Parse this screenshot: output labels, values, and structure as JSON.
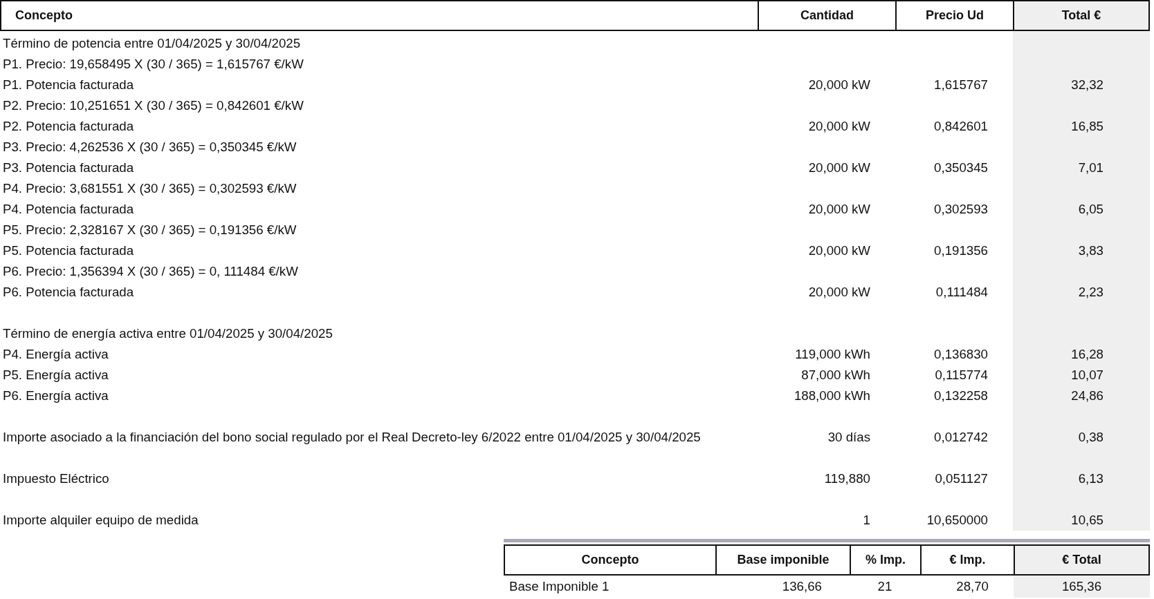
{
  "table": {
    "columns": [
      {
        "label": "Concepto",
        "highlighted": false
      },
      {
        "label": "Cantidad",
        "highlighted": false
      },
      {
        "label": "Precio Ud",
        "highlighted": false
      },
      {
        "label": "Total €",
        "highlighted": true
      }
    ],
    "sections": [
      {
        "rows": [
          {
            "kind": "heading",
            "concept": "Término de potencia entre 01/04/2025 y 30/04/2025"
          },
          {
            "kind": "heading",
            "concept": "P1. Precio: 19,658495 X (30 / 365) = 1,615767 €/kW"
          },
          {
            "kind": "item",
            "concept": "P1. Potencia facturada",
            "quantity": "20,000 kW",
            "price": "1,615767",
            "total": "32,32"
          },
          {
            "kind": "heading",
            "concept": "P2. Precio: 10,251651 X (30 / 365) = 0,842601 €/kW"
          },
          {
            "kind": "item",
            "concept": "P2. Potencia facturada",
            "quantity": "20,000 kW",
            "price": "0,842601",
            "total": "16,85"
          },
          {
            "kind": "heading",
            "concept": "P3. Precio: 4,262536 X (30 / 365) = 0,350345 €/kW"
          },
          {
            "kind": "item",
            "concept": "P3. Potencia facturada",
            "quantity": "20,000 kW",
            "price": "0,350345",
            "total": "7,01"
          },
          {
            "kind": "heading",
            "concept": "P4. Precio: 3,681551 X (30 / 365) = 0,302593 €/kW"
          },
          {
            "kind": "item",
            "concept": "P4. Potencia facturada",
            "quantity": "20,000 kW",
            "price": "0,302593",
            "total": "6,05"
          },
          {
            "kind": "heading",
            "concept": "P5. Precio: 2,328167 X (30 / 365) = 0,191356 €/kW"
          },
          {
            "kind": "item",
            "concept": "P5. Potencia facturada",
            "quantity": "20,000 kW",
            "price": "0,191356",
            "total": "3,83"
          },
          {
            "kind": "heading",
            "concept": "P6. Precio: 1,356394 X (30 / 365) = 0, 111484 €/kW"
          },
          {
            "kind": "item",
            "concept": "P6. Potencia facturada",
            "quantity": "20,000 kW",
            "price": "0,111484",
            "total": "2,23"
          }
        ]
      },
      {
        "rows": [
          {
            "kind": "heading",
            "concept": "Término de energía activa entre 01/04/2025 y 30/04/2025"
          },
          {
            "kind": "item",
            "concept": "P4. Energía activa",
            "quantity": "119,000 kWh",
            "price": "0,136830",
            "total": "16,28"
          },
          {
            "kind": "item",
            "concept": "P5. Energía activa",
            "quantity": "87,000 kWh",
            "price": "0,115774",
            "total": "10,07"
          },
          {
            "kind": "item",
            "concept": "P6. Energía activa",
            "quantity": "188,000 kWh",
            "price": "0,132258",
            "total": "24,86"
          }
        ]
      },
      {
        "rows": [
          {
            "kind": "item",
            "concept": "Importe asociado a la financiación del bono social regulado por el Real Decreto-ley 6/2022 entre 01/04/2025 y 30/04/2025",
            "quantity": "30 días",
            "price": "0,012742",
            "total": "0,38"
          }
        ]
      },
      {
        "rows": [
          {
            "kind": "item",
            "concept": "Impuesto Eléctrico",
            "quantity": "119,880",
            "price": "0,051127",
            "total": "6,13"
          }
        ]
      },
      {
        "rows": [
          {
            "kind": "item",
            "concept": "Importe alquiler equipo de medida",
            "quantity": "1",
            "price": "10,650000",
            "total": "10,65"
          }
        ]
      }
    ]
  },
  "tax_table": {
    "columns": [
      {
        "label": "Concepto",
        "highlighted": false
      },
      {
        "label": "Base imponible",
        "highlighted": false
      },
      {
        "label": "% Imp.",
        "highlighted": false
      },
      {
        "label": "€ Imp.",
        "highlighted": false
      },
      {
        "label": "€ Total",
        "highlighted": true
      }
    ],
    "rows": [
      {
        "concept": "Base Imponible 1",
        "base": "136,66",
        "rate": "21",
        "tax": "28,70",
        "total": "165,36"
      }
    ]
  }
}
